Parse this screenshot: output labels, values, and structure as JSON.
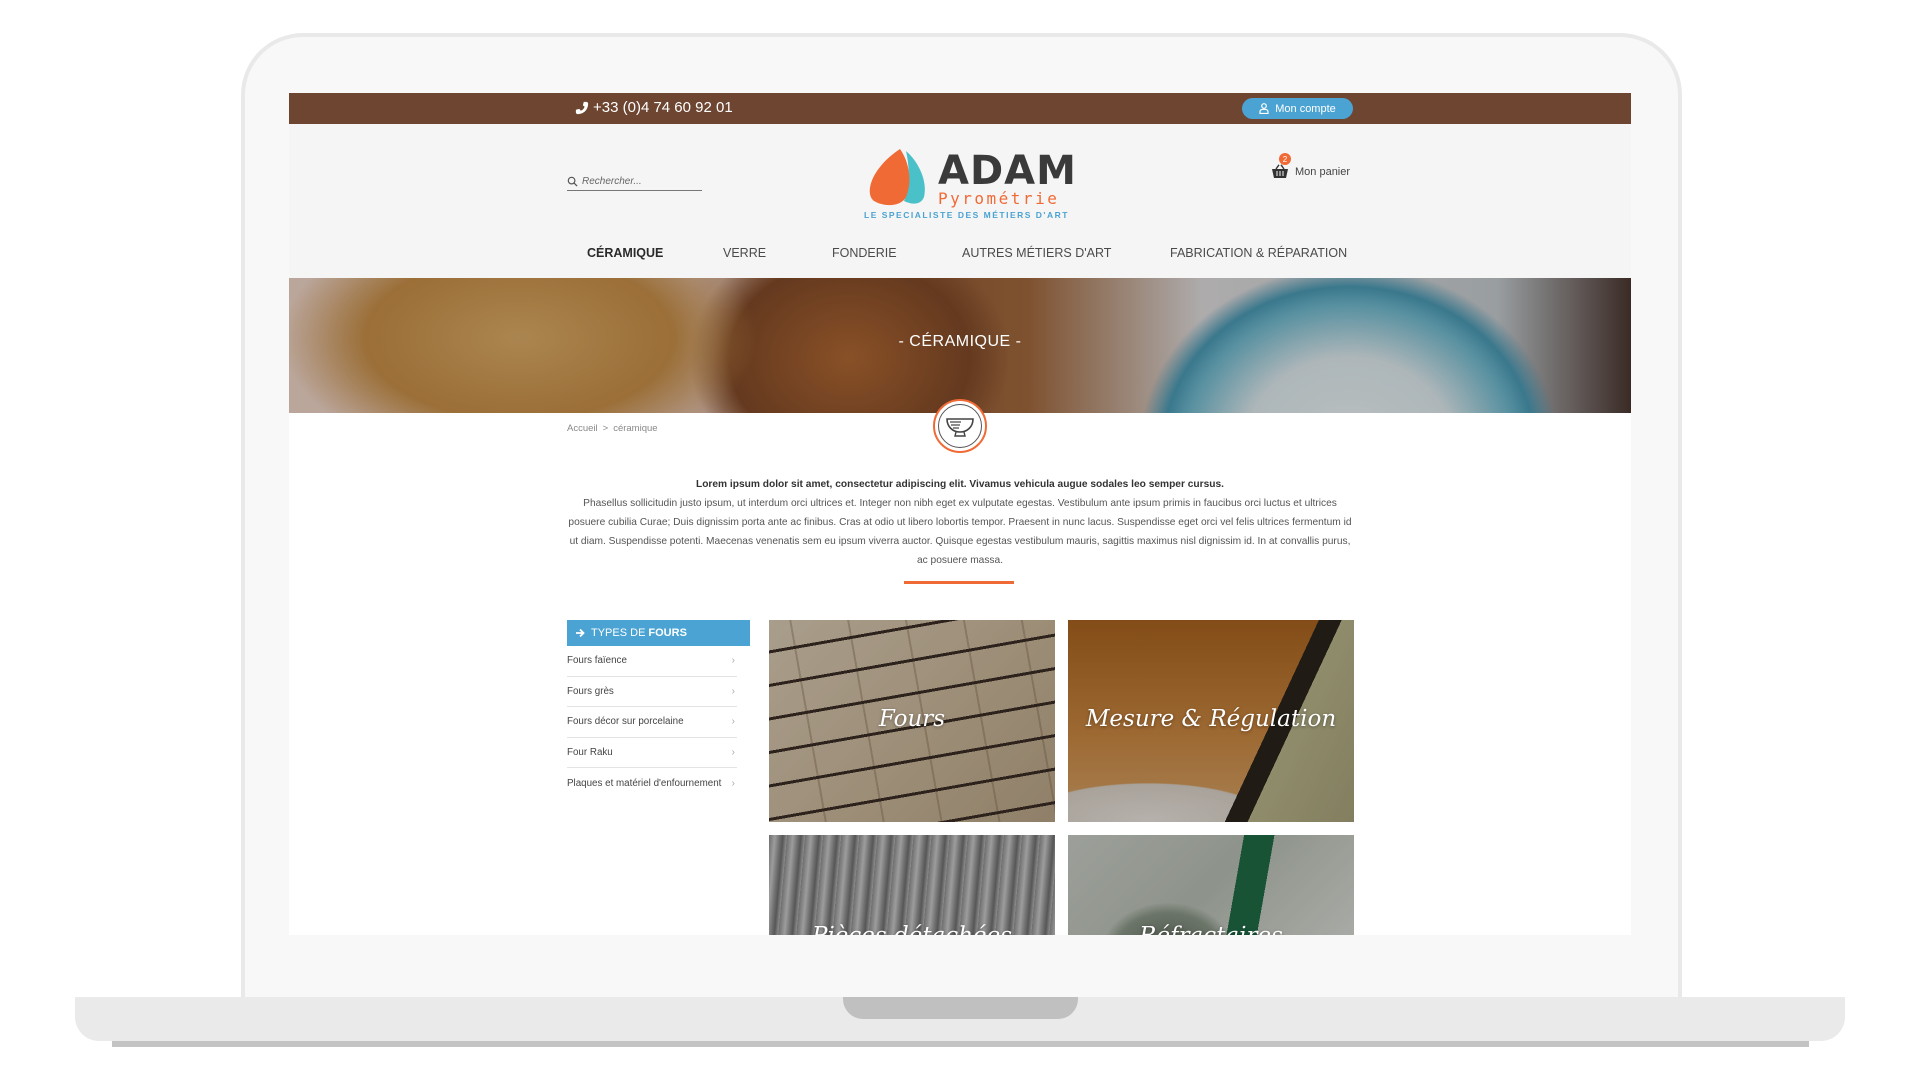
{
  "topbar": {
    "phone": "+33 (0)4 74 60 92 01",
    "account_label": "Mon compte"
  },
  "header": {
    "search_placeholder": "Rechercher...",
    "logo": {
      "title": "ADAM",
      "subtitle": "Pyrométrie",
      "tagline": "LE SPECIALISTE DES MÉTIERS D'ART"
    },
    "cart": {
      "label": "Mon panier",
      "count": "2"
    }
  },
  "nav": {
    "items": [
      {
        "label": "CÉRAMIQUE",
        "active": true
      },
      {
        "label": "VERRE",
        "active": false
      },
      {
        "label": "FONDERIE",
        "active": false
      },
      {
        "label": "AUTRES MÉTIERS D'ART",
        "active": false
      },
      {
        "label": "FABRICATION & RÉPARATION",
        "active": false
      }
    ]
  },
  "hero": {
    "title": "- CÉRAMIQUE -",
    "badge_icon": "bowl-icon"
  },
  "breadcrumb": {
    "home": "Accueil",
    "separator": ">",
    "current": "céramique"
  },
  "intro": {
    "lead": "Lorem ipsum dolor sit amet, consectetur adipiscing elit. Vivamus vehicula augue sodales leo semper cursus.",
    "body": "Phasellus sollicitudin justo ipsum, ut interdum orci ultrices et. Integer non nibh eget ex vulputate egestas. Vestibulum ante ipsum primis in faucibus orci luctus et ultrices posuere cubilia Curae; Duis dignissim porta ante ac finibus. Cras at odio ut libero lobortis tempor. Praesent in nunc lacus. Suspendisse eget orci vel felis ultrices fermentum id ut diam. Suspendisse potenti. Maecenas venenatis sem eu ipsum viverra auctor. Quisque egestas vestibulum mauris, sagittis maximus nisl dignissim id. In at convallis purus, ac posuere massa."
  },
  "sidebar": {
    "heading_prefix": "TYPES DE",
    "heading_bold": "FOURS",
    "items": [
      {
        "label": "Fours faïence"
      },
      {
        "label": "Fours grès"
      },
      {
        "label": "Fours décor sur porcelaine"
      },
      {
        "label": "Four Raku"
      },
      {
        "label": "Plaques et matériel d'enfournement"
      }
    ]
  },
  "cards": [
    {
      "label": "Fours"
    },
    {
      "label": "Mesure & Régulation"
    },
    {
      "label": "Pièces détachées"
    },
    {
      "label": "Réfractaires"
    }
  ],
  "colors": {
    "topbar": "#6d4530",
    "accent_blue": "#4aa3d3",
    "accent_orange": "#f06a35"
  }
}
